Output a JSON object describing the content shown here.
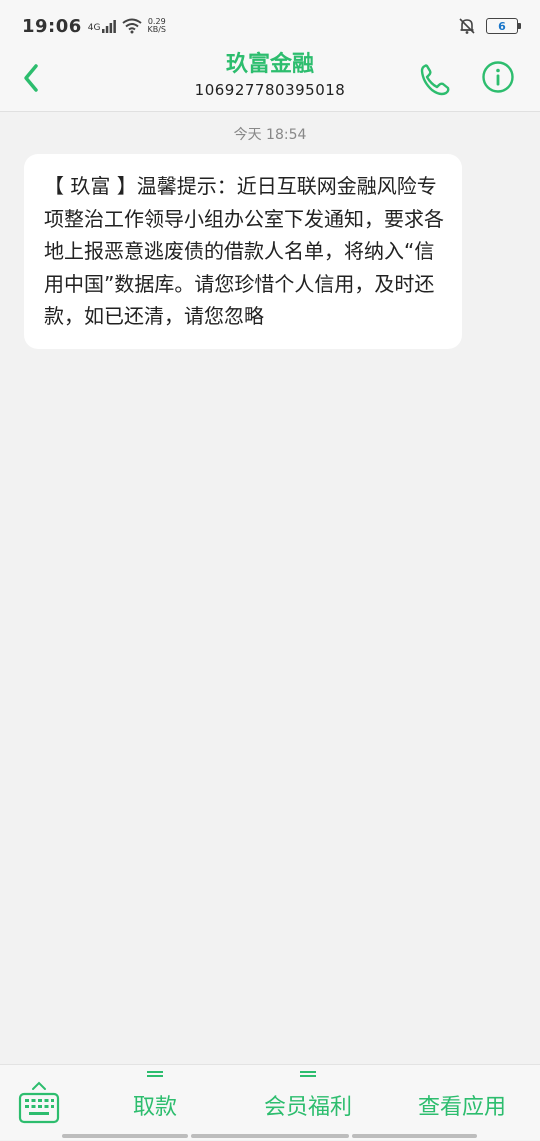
{
  "status": {
    "time": "19:06",
    "network": "4G",
    "speed_value": "0.29",
    "speed_unit": "KB/S",
    "battery": "6"
  },
  "header": {
    "contact_name": "玖富金融",
    "contact_number": "106927780395018"
  },
  "thread": {
    "timestamp": "今天 18:54",
    "message": "【 玖富 】温馨提示：近日互联网金融风险专项整治工作领导小组办公室下发通知，要求各地上报恶意逃废债的借款人名单，将纳入“信用中国”数据库。请您珍惜个人信用，及时还款，如已还清，请您忽略"
  },
  "bottom_menu": [
    {
      "label": "取款"
    },
    {
      "label": "会员福利"
    },
    {
      "label": "查看应用"
    }
  ],
  "colors": {
    "accent": "#2dbd6e",
    "background": "#f2f2f2",
    "bubble": "#ffffff"
  },
  "icons": {
    "back": "chevron-left-icon",
    "call": "phone-icon",
    "info": "info-icon",
    "keyboard": "keyboard-icon"
  }
}
